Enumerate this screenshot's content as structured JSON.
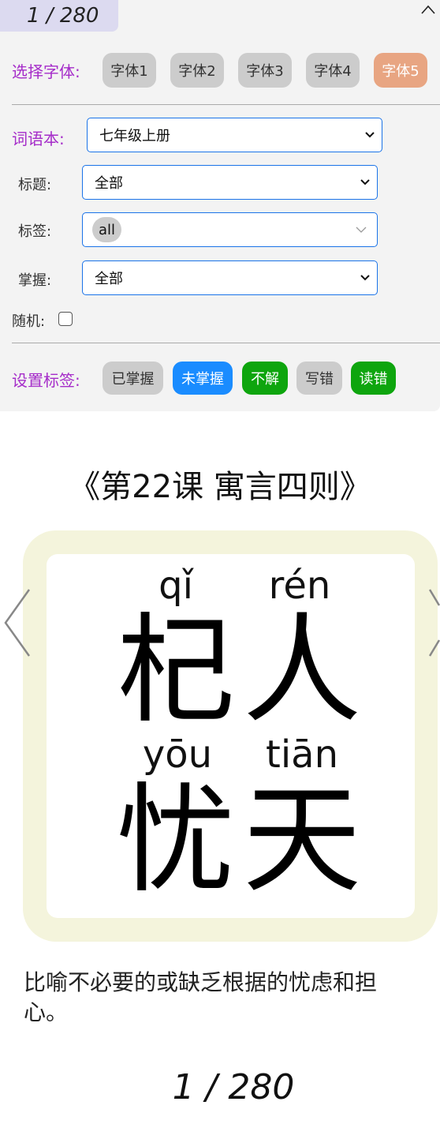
{
  "counter": "1 / 280",
  "fonts": {
    "label": "选择字体:",
    "options": [
      "字体1",
      "字体2",
      "字体3",
      "字体4",
      "字体5"
    ],
    "selected_index": 4,
    "selected_color": "#e8a582"
  },
  "filters": {
    "wordbook": {
      "label": "词语本:",
      "value": "七年级上册"
    },
    "title": {
      "label": "标题:",
      "value": "全部"
    },
    "tags": {
      "label": "标签:",
      "value": "all"
    },
    "mastery": {
      "label": "掌握:",
      "value": "全部"
    },
    "random": {
      "label": "随机:",
      "checked": false
    }
  },
  "set_tags": {
    "label": "设置标签:",
    "buttons": [
      {
        "label": "已掌握",
        "bg": "#cccccc",
        "fg": "#333333"
      },
      {
        "label": "未掌握",
        "bg": "#1a8cff",
        "fg": "#ffffff"
      },
      {
        "label": "不解",
        "bg": "#0ea50e",
        "fg": "#ffffff"
      },
      {
        "label": "写错",
        "bg": "#cccccc",
        "fg": "#333333"
      },
      {
        "label": "读错",
        "bg": "#0ea50e",
        "fg": "#ffffff"
      }
    ]
  },
  "lesson_title": "《第22课 寓言四则》",
  "card": {
    "chars": [
      {
        "pinyin": "qǐ",
        "hanzi": "杞"
      },
      {
        "pinyin": "rén",
        "hanzi": "人"
      },
      {
        "pinyin": "yōu",
        "hanzi": "忧"
      },
      {
        "pinyin": "tiān",
        "hanzi": "天"
      }
    ]
  },
  "meaning": "比喻不必要的或缺乏根据的忧虑和担心。",
  "bottom_counter": "1 / 280",
  "icons": {
    "collapse": "chevron-up-icon",
    "prev": "chevron-left-icon",
    "next": "chevron-right-icon",
    "dropdown": "chevron-down-icon"
  }
}
